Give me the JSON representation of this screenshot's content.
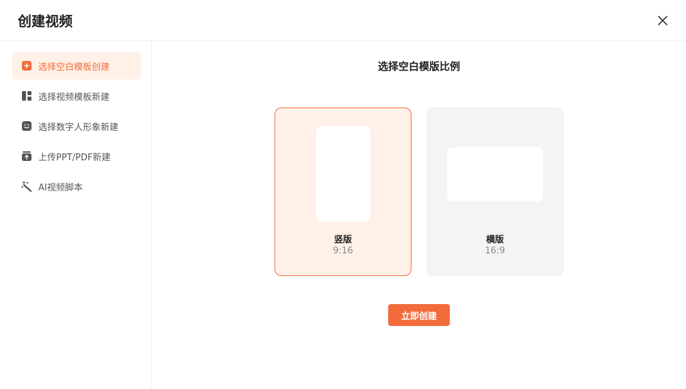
{
  "dialog": {
    "title": "创建视频",
    "close_icon": "close-icon"
  },
  "sidebar": {
    "items": [
      {
        "label": "选择空白模板创建",
        "icon": "plus-square-icon",
        "active": true
      },
      {
        "label": "选择视频模板新建",
        "icon": "layout-icon",
        "active": false
      },
      {
        "label": "选择数字人形象新建",
        "icon": "smiley-icon",
        "active": false
      },
      {
        "label": "上传PPT/PDF新建",
        "icon": "upload-box-icon",
        "active": false
      },
      {
        "label": "AI视频脚本",
        "icon": "magic-wand-icon",
        "active": false
      }
    ]
  },
  "main": {
    "heading": "选择空白模版比例",
    "options": [
      {
        "label": "竖版",
        "ratio": "9:16",
        "selected": true
      },
      {
        "label": "横版",
        "ratio": "16:9",
        "selected": false
      }
    ],
    "create_label": "立即创建"
  },
  "colors": {
    "accent": "#f26b3a",
    "accent_light": "#fff1e8",
    "icon_gray": "#555555",
    "card_gray": "#f4f4f4"
  }
}
